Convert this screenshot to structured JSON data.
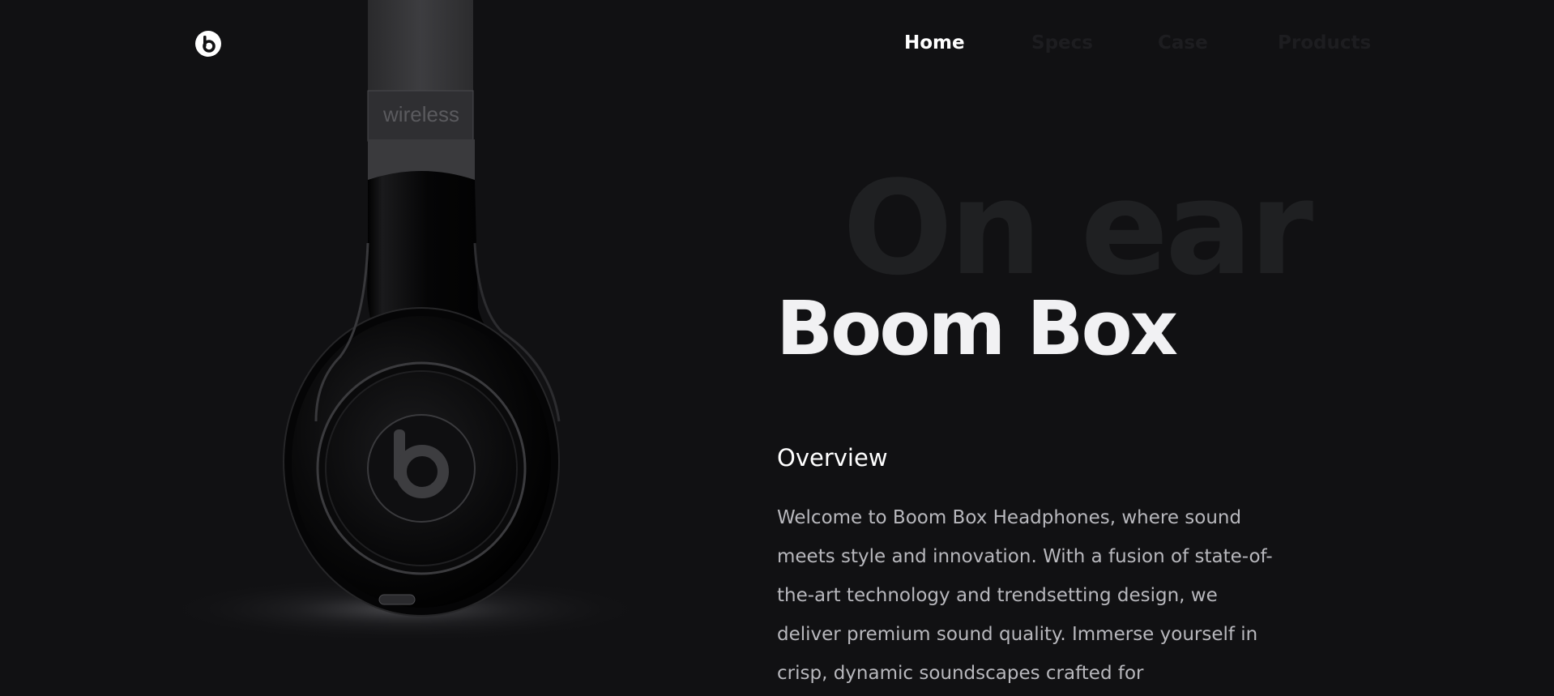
{
  "header": {
    "logo_icon": "beats-logo-icon",
    "nav": [
      {
        "label": "Home",
        "active": true
      },
      {
        "label": "Specs",
        "active": false
      },
      {
        "label": "Case",
        "active": false
      },
      {
        "label": "Products",
        "active": false
      }
    ]
  },
  "hero": {
    "product_image_text": "wireless",
    "background_word": "On ear",
    "title": "Boom Box",
    "overview_heading": "Overview",
    "overview_text": "Welcome to Boom Box Headphones, where sound meets style and innovation. With a fusion of state-of-the-art technology and trendsetting design, we deliver premium sound quality. Immerse yourself in crisp, dynamic soundscapes crafted for"
  },
  "colors": {
    "background": "#111113",
    "title": "#f1f1f3",
    "nav_active": "#ffffff",
    "nav_inactive": "#1d1d20",
    "background_word": "#1f2022",
    "body_text": "#b8b8bd"
  }
}
